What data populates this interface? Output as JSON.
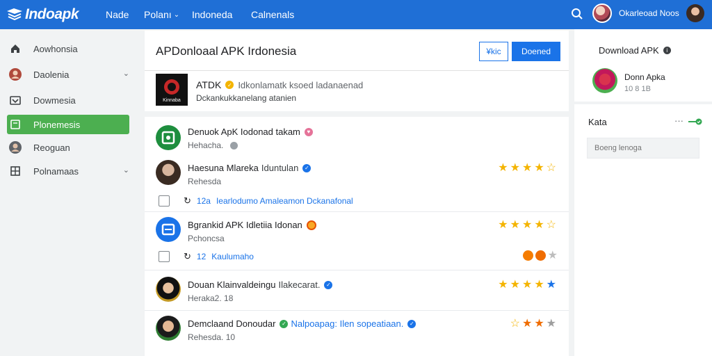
{
  "app": {
    "logo_text": "Indoapk"
  },
  "nav": [
    {
      "label": "Nade",
      "caret": ""
    },
    {
      "label": "Polanı",
      "caret": "⌄"
    },
    {
      "label": "Indoneda",
      "caret": ""
    },
    {
      "label": "Calnenals",
      "caret": ""
    }
  ],
  "account": {
    "name": "Okarleoad Noos"
  },
  "sidebar": {
    "items": [
      {
        "label": "Aowhonsia",
        "icon": "home-icon",
        "chevron": ""
      },
      {
        "label": "Daolenia",
        "icon": "user-avatar-icon",
        "chevron": "⌄"
      },
      {
        "label": "Dowmesia",
        "icon": "download-icon",
        "chevron": ""
      },
      {
        "label": "Plonemesis",
        "icon": "folder-icon",
        "chevron": ""
      },
      {
        "label": "Reoguan",
        "icon": "person-icon",
        "chevron": ""
      },
      {
        "label": "Polnamaas",
        "icon": "apps-grid-icon",
        "chevron": "⌄"
      }
    ]
  },
  "main": {
    "title": "APDonloaal APK Irdonesia",
    "btn_outline": "¥kic",
    "btn_primary": "Doened"
  },
  "featured": {
    "name": "ATDK",
    "description": "Idkonlamatk ksoed ladanaenad",
    "subtitle": "Dckankukkanelang atanien",
    "logo_text": "Kinnaba"
  },
  "rows": [
    {
      "name": "Denuok ApK Iodonad takam",
      "extra": "",
      "badge": "pink",
      "sub": "Hehacha.",
      "stars": [],
      "subline": null
    },
    {
      "name": "Haesuna Mlareka",
      "extra": "Iduntulan",
      "badge": "blue",
      "sub": "Rehesda",
      "stars": [
        "★",
        "★",
        "★",
        "★",
        "☆"
      ],
      "subline": {
        "arrow": "↻",
        "num": "12a",
        "text": "Iearlodumo Amaleamon Dckanafonal"
      }
    },
    {
      "name": "Bgrankid APK Idletiia Idonan",
      "extra": "",
      "badge": "emoji",
      "sub": "Pchoncsa",
      "stars": [
        "★",
        "★",
        "★",
        "★",
        "☆"
      ],
      "subline": {
        "arrow": "↻",
        "num": "12",
        "text": "Kaulumaho"
      }
    },
    {
      "name": "Douan Klainvaldeingu",
      "extra": "Ilakecarat.",
      "badge": "blue",
      "sub": "Heraka2. 18",
      "stars": [
        "★",
        "★",
        "★",
        "★",
        "★"
      ],
      "subline": null
    },
    {
      "name": "Demclaand Donoudar",
      "extra": "Nalpoapag: Ilen sopeatiaan.",
      "badge": "green",
      "sub": "Rehesda. 10",
      "stars": [
        "☆",
        "★",
        "★",
        "★"
      ],
      "subline": null
    }
  ],
  "right_panel": {
    "title": "Download APK",
    "user_name": "Donn Apka",
    "user_sub": "10 8 1B",
    "kata_label": "Kata",
    "dots": "···",
    "input_placeholder": "Boeng lenoga"
  },
  "colors": {
    "topbar": "#1f6fd6",
    "accent": "#1a73e8",
    "active_item": "#4caf50",
    "star": "#f4b400"
  }
}
